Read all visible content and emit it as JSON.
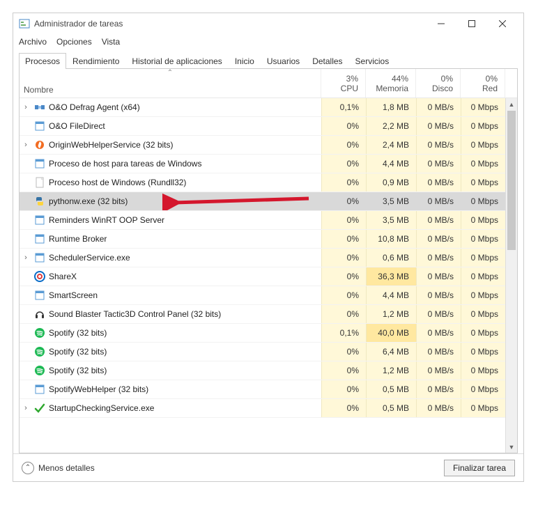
{
  "window": {
    "title": "Administrador de tareas"
  },
  "menu": {
    "archivo": "Archivo",
    "opciones": "Opciones",
    "vista": "Vista"
  },
  "tabs": {
    "procesos": "Procesos",
    "rendimiento": "Rendimiento",
    "historial": "Historial de aplicaciones",
    "inicio": "Inicio",
    "usuarios": "Usuarios",
    "detalles": "Detalles",
    "servicios": "Servicios"
  },
  "headers": {
    "nombre": "Nombre",
    "cpu_pct": "3%",
    "cpu": "CPU",
    "mem_pct": "44%",
    "mem": "Memoria",
    "disco_pct": "0%",
    "disco": "Disco",
    "red_pct": "0%",
    "red": "Red"
  },
  "processes": [
    {
      "expand": true,
      "icon": "defrag",
      "name": "O&O Defrag Agent (x64)",
      "cpu": "0,1%",
      "mem": "1,8 MB",
      "disk": "0 MB/s",
      "net": "0 Mbps"
    },
    {
      "expand": false,
      "icon": "doc",
      "name": "O&O FileDirect",
      "cpu": "0%",
      "mem": "2,2 MB",
      "disk": "0 MB/s",
      "net": "0 Mbps"
    },
    {
      "expand": true,
      "icon": "origin",
      "name": "OriginWebHelperService (32 bits)",
      "cpu": "0%",
      "mem": "2,4 MB",
      "disk": "0 MB/s",
      "net": "0 Mbps"
    },
    {
      "expand": false,
      "icon": "doc",
      "name": "Proceso de host para tareas de Windows",
      "cpu": "0%",
      "mem": "4,4 MB",
      "disk": "0 MB/s",
      "net": "0 Mbps"
    },
    {
      "expand": false,
      "icon": "blank",
      "name": "Proceso host de Windows (Rundll32)",
      "cpu": "0%",
      "mem": "0,9 MB",
      "disk": "0 MB/s",
      "net": "0 Mbps"
    },
    {
      "expand": false,
      "icon": "python",
      "name": "pythonw.exe (32 bits)",
      "cpu": "0%",
      "mem": "3,5 MB",
      "disk": "0 MB/s",
      "net": "0 Mbps",
      "selected": true
    },
    {
      "expand": false,
      "icon": "doc",
      "name": "Reminders WinRT OOP Server",
      "cpu": "0%",
      "mem": "3,5 MB",
      "disk": "0 MB/s",
      "net": "0 Mbps"
    },
    {
      "expand": false,
      "icon": "doc",
      "name": "Runtime Broker",
      "cpu": "0%",
      "mem": "10,8 MB",
      "disk": "0 MB/s",
      "net": "0 Mbps"
    },
    {
      "expand": true,
      "icon": "doc",
      "name": "SchedulerService.exe",
      "cpu": "0%",
      "mem": "0,6 MB",
      "disk": "0 MB/s",
      "net": "0 Mbps"
    },
    {
      "expand": false,
      "icon": "sharex",
      "name": "ShareX",
      "cpu": "0%",
      "mem": "36,3 MB",
      "disk": "0 MB/s",
      "net": "0 Mbps"
    },
    {
      "expand": false,
      "icon": "doc",
      "name": "SmartScreen",
      "cpu": "0%",
      "mem": "4,4 MB",
      "disk": "0 MB/s",
      "net": "0 Mbps"
    },
    {
      "expand": false,
      "icon": "headphones",
      "name": "Sound Blaster Tactic3D Control Panel (32 bits)",
      "cpu": "0%",
      "mem": "1,2 MB",
      "disk": "0 MB/s",
      "net": "0 Mbps"
    },
    {
      "expand": false,
      "icon": "spotify",
      "name": "Spotify (32 bits)",
      "cpu": "0,1%",
      "mem": "40,0 MB",
      "disk": "0 MB/s",
      "net": "0 Mbps"
    },
    {
      "expand": false,
      "icon": "spotify",
      "name": "Spotify (32 bits)",
      "cpu": "0%",
      "mem": "6,4 MB",
      "disk": "0 MB/s",
      "net": "0 Mbps"
    },
    {
      "expand": false,
      "icon": "spotify",
      "name": "Spotify (32 bits)",
      "cpu": "0%",
      "mem": "1,2 MB",
      "disk": "0 MB/s",
      "net": "0 Mbps"
    },
    {
      "expand": false,
      "icon": "doc",
      "name": "SpotifyWebHelper (32 bits)",
      "cpu": "0%",
      "mem": "0,5 MB",
      "disk": "0 MB/s",
      "net": "0 Mbps"
    },
    {
      "expand": true,
      "icon": "check",
      "name": "StartupCheckingService.exe",
      "cpu": "0%",
      "mem": "0,5 MB",
      "disk": "0 MB/s",
      "net": "0 Mbps"
    }
  ],
  "footer": {
    "fewer": "Menos detalles",
    "end": "Finalizar tarea"
  },
  "highlight_index": 5
}
